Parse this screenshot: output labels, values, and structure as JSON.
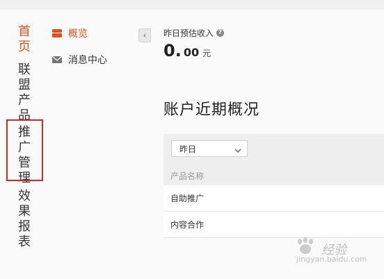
{
  "left_nav": {
    "items": [
      {
        "label": "首页",
        "active": true
      },
      {
        "label": "联盟产品",
        "active": false
      },
      {
        "label": "推广管理",
        "active": false,
        "highlighted": true
      },
      {
        "label": "效果报表",
        "active": false
      }
    ]
  },
  "sub_nav": {
    "items": [
      {
        "label": "概览",
        "icon": "overview-icon",
        "active": true
      },
      {
        "label": "消息中心",
        "icon": "mail-icon",
        "active": false
      }
    ],
    "collapse_glyph": "‹"
  },
  "earnings": {
    "label": "昨日预估收入",
    "integer": "0.",
    "decimal": "00",
    "unit": "元"
  },
  "section": {
    "title": "账户近期概况"
  },
  "table": {
    "period_select": "昨日",
    "column_header": "产品名称",
    "rows": [
      "自助推广",
      "内容合作"
    ]
  },
  "watermark": {
    "brand": "经验",
    "url": "jingyan.baidu.com"
  },
  "colors": {
    "accent": "#e0501e",
    "highlight_box": "#cc2a2a"
  }
}
